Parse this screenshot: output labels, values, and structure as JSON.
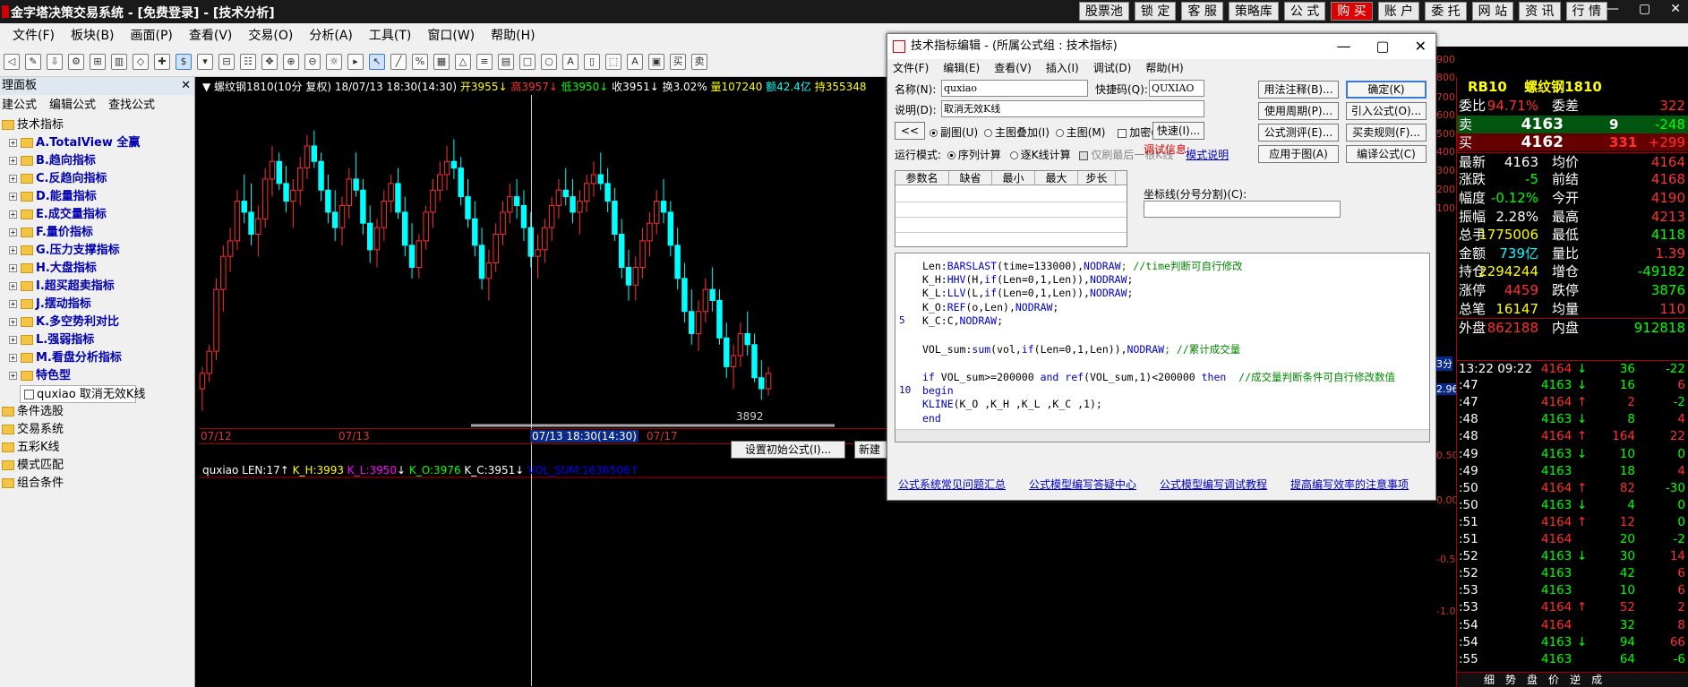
{
  "app": {
    "title": "金字塔决策交易系统 - [免费登录] - [技术分析]",
    "top_buttons": [
      "股票池",
      "锁 定",
      "客 服",
      "策略库",
      "公 式",
      "购 买",
      "账 户",
      "委 托",
      "网 站",
      "资 讯",
      "行 情"
    ],
    "window_controls": [
      "—",
      "▢",
      "✕"
    ]
  },
  "menu": [
    "文件(F)",
    "板块(B)",
    "画面(P)",
    "查看(V)",
    "交易(O)",
    "分析(A)",
    "工具(T)",
    "窗口(W)",
    "帮助(H)"
  ],
  "left_panel": {
    "header": "理面板",
    "tabs": [
      "建公式",
      "编辑公式",
      "查找公式"
    ],
    "tree": [
      {
        "label": "技术指标",
        "level": 0,
        "expanded": true
      },
      {
        "label": "A.TotalView 全赢",
        "level": 1
      },
      {
        "label": "B.趋向指标",
        "level": 1
      },
      {
        "label": "C.反趋向指标",
        "level": 1
      },
      {
        "label": "D.能量指标",
        "level": 1
      },
      {
        "label": "E.成交量指标",
        "level": 1
      },
      {
        "label": "F.量价指标",
        "level": 1
      },
      {
        "label": "G.压力支撑指标",
        "level": 1
      },
      {
        "label": "H.大盘指标",
        "level": 1
      },
      {
        "label": "I.超买超卖指标",
        "level": 1
      },
      {
        "label": "J.摆动指标",
        "level": 1
      },
      {
        "label": "K.多空势利对比",
        "level": 1
      },
      {
        "label": "L.强弱指标",
        "level": 1
      },
      {
        "label": "M.看盘分析指标",
        "level": 1
      },
      {
        "label": "特色型",
        "level": 1
      },
      {
        "label": "quxiao 取消无效K线",
        "level": 2
      },
      {
        "label": "条件选股",
        "level": 0
      },
      {
        "label": "交易系统",
        "level": 0
      },
      {
        "label": "五彩K线",
        "level": 0
      },
      {
        "label": "模式匹配",
        "level": 0
      },
      {
        "label": "组合条件",
        "level": 0
      }
    ]
  },
  "chart": {
    "header": [
      {
        "t": "▼ 螺纹钢1810(10分 复权) 18/07/13 18:30(14:30)",
        "c": "#ffffff"
      },
      {
        "t": " 开3955↓",
        "c": "#ffff00"
      },
      {
        "t": " 高3957↓",
        "c": "#ff3030"
      },
      {
        "t": " 低3950↓",
        "c": "#00ff00"
      },
      {
        "t": " 收3951↓",
        "c": "#ffffff"
      },
      {
        "t": " 换3.02%",
        "c": "#ffffff"
      },
      {
        "t": " 量107240",
        "c": "#ffff00"
      },
      {
        "t": " 额42.4亿",
        "c": "#00ffff"
      },
      {
        "t": " 持355348",
        "c": "#ffff00"
      }
    ],
    "dates": [
      "07/12",
      "07/13",
      "07/17"
    ],
    "selected_date": "07/13 18:30(14:30)",
    "low_label": "3892",
    "buttons": {
      "set_init": "设置初始公式(I)...",
      "new": "新建"
    },
    "sub_header": [
      {
        "t": "quxiao LEN:17↑",
        "c": "#ffffff"
      },
      {
        "t": " K_H:3993",
        "c": "#ffff00"
      },
      {
        "t": " K_L:3950",
        "c": "#ff00ff"
      },
      {
        "t": "↓",
        "c": "#ffffff"
      },
      {
        "t": " K_O:3976",
        "c": "#00ff00"
      },
      {
        "t": " K_C:3951↓",
        "c": "#ffffff"
      },
      {
        "t": " VOL_SUM:1636506↑",
        "c": "#0000ff"
      }
    ]
  },
  "chart_data": {
    "type": "candlestick",
    "note_units": "price",
    "ylim": [
      3880,
      4020
    ],
    "candles": [
      [
        3895,
        3905,
        3885,
        3902
      ],
      [
        3902,
        3915,
        3898,
        3912
      ],
      [
        3912,
        3945,
        3908,
        3940
      ],
      [
        3940,
        3960,
        3930,
        3955
      ],
      [
        3955,
        3968,
        3948,
        3962
      ],
      [
        3962,
        3985,
        3958,
        3980
      ],
      [
        3980,
        3992,
        3970,
        3975
      ],
      [
        3975,
        3988,
        3960,
        3965
      ],
      [
        3965,
        3978,
        3955,
        3972
      ],
      [
        3972,
        3995,
        3968,
        3990
      ],
      [
        3990,
        4005,
        3982,
        3998
      ],
      [
        3998,
        4002,
        3985,
        3988
      ],
      [
        3988,
        3996,
        3975,
        3980
      ],
      [
        3980,
        3990,
        3968,
        3985
      ],
      [
        3985,
        4000,
        3978,
        3995
      ],
      [
        3995,
        4010,
        3990,
        4005
      ],
      [
        4005,
        4012,
        3995,
        3998
      ],
      [
        3998,
        4002,
        3980,
        3985
      ],
      [
        3985,
        3992,
        3970,
        3975
      ],
      [
        3975,
        3985,
        3962,
        3968
      ],
      [
        3968,
        3982,
        3960,
        3978
      ],
      [
        3978,
        3995,
        3972,
        3990
      ],
      [
        3990,
        4002,
        3982,
        3985
      ],
      [
        3985,
        3990,
        3965,
        3970
      ],
      [
        3970,
        3978,
        3952,
        3958
      ],
      [
        3958,
        3972,
        3950,
        3968
      ],
      [
        3968,
        3985,
        3962,
        3980
      ],
      [
        3980,
        3992,
        3975,
        3988
      ],
      [
        3988,
        3995,
        3972,
        3975
      ],
      [
        3975,
        3982,
        3955,
        3960
      ],
      [
        3960,
        3970,
        3945,
        3950
      ],
      [
        3950,
        3965,
        3945,
        3962
      ],
      [
        3962,
        3978,
        3958,
        3975
      ],
      [
        3975,
        3990,
        3968,
        3985
      ],
      [
        3985,
        3998,
        3980,
        3992
      ],
      [
        3992,
        4005,
        3985,
        3998
      ],
      [
        3998,
        4008,
        3990,
        3995
      ],
      [
        3995,
        4000,
        3978,
        3982
      ],
      [
        3982,
        3990,
        3968,
        3972
      ],
      [
        3972,
        3980,
        3955,
        3960
      ],
      [
        3960,
        3968,
        3940,
        3945
      ],
      [
        3945,
        3958,
        3935,
        3952
      ],
      [
        3952,
        3970,
        3948,
        3965
      ],
      [
        3965,
        3980,
        3960,
        3975
      ],
      [
        3975,
        3988,
        3970,
        3982
      ],
      [
        3982,
        3990,
        3972,
        3978
      ],
      [
        3978,
        3985,
        3962,
        3968
      ],
      [
        3968,
        3975,
        3950,
        3955
      ],
      [
        3955,
        3965,
        3945,
        3958
      ],
      [
        3958,
        3972,
        3952,
        3968
      ],
      [
        3968,
        3982,
        3962,
        3978
      ],
      [
        3978,
        3990,
        3972,
        3985
      ],
      [
        3985,
        3995,
        3978,
        3982
      ],
      [
        3982,
        3990,
        3970,
        3975
      ],
      [
        3975,
        3985,
        3965,
        3980
      ],
      [
        3980,
        3992,
        3975,
        3988
      ],
      [
        3988,
        3998,
        3982,
        3992
      ],
      [
        3992,
        4002,
        3985,
        3988
      ],
      [
        3988,
        3995,
        3975,
        3980
      ],
      [
        3980,
        3986,
        3962,
        3965
      ],
      [
        3965,
        3972,
        3945,
        3950
      ],
      [
        3950,
        3958,
        3935,
        3942
      ],
      [
        3942,
        3955,
        3935,
        3950
      ],
      [
        3950,
        3968,
        3945,
        3962
      ],
      [
        3962,
        3975,
        3955,
        3970
      ],
      [
        3970,
        3985,
        3965,
        3980
      ],
      [
        3980,
        3990,
        3970,
        3975
      ],
      [
        3975,
        3980,
        3955,
        3960
      ],
      [
        3960,
        3968,
        3940,
        3945
      ],
      [
        3945,
        3952,
        3925,
        3930
      ],
      [
        3930,
        3940,
        3915,
        3920
      ],
      [
        3920,
        3935,
        3912,
        3930
      ],
      [
        3930,
        3945,
        3925,
        3940
      ],
      [
        3940,
        3950,
        3930,
        3935
      ],
      [
        3935,
        3940,
        3915,
        3918
      ],
      [
        3918,
        3925,
        3900,
        3905
      ],
      [
        3905,
        3915,
        3895,
        3910
      ],
      [
        3910,
        3925,
        3905,
        3920
      ],
      [
        3920,
        3930,
        3910,
        3915
      ],
      [
        3915,
        3920,
        3898,
        3900
      ],
      [
        3900,
        3908,
        3890,
        3895
      ],
      [
        3895,
        3905,
        3892,
        3902
      ]
    ]
  },
  "dialog": {
    "title": "技术指标编辑 - (所属公式组 : 技术指标)",
    "menu": [
      "文件(F)",
      "编辑(E)",
      "查看(V)",
      "插入(I)",
      "调试(D)",
      "帮助(H)"
    ],
    "name_label": "名称(N):",
    "name_value": "quxiao",
    "shortcut_label": "快捷码(Q):",
    "shortcut_value": "QUXIAO",
    "desc_label": "说明(D):",
    "desc_value": "取消无效K线",
    "nav_button": "<<",
    "draw_options": [
      "副图(U)",
      "主图叠加(I)",
      "主图(M)"
    ],
    "encrypt": "加密(Y)",
    "quick_button": "快速(I)...",
    "run_mode_label": "运行模式:",
    "run_modes": [
      "序列计算",
      "逐K线计算"
    ],
    "refresh_last": "仅刷最后一根K线",
    "mode_help": "模式说明",
    "param_headers": [
      "参数名",
      "缺省",
      "最小",
      "最大",
      "步长"
    ],
    "debug_label": "调试信息:",
    "axis_label": "坐标线(分号分割)(C):",
    "buttons_right": [
      [
        "用法注释(B)...",
        "确定(K)"
      ],
      [
        "使用周期(P)...",
        "引入公式(O)..."
      ],
      [
        "公式测评(E)...",
        "买卖规则(F)..."
      ],
      [
        "应用于图(A)",
        "编译公式(C)"
      ]
    ],
    "code": [
      {
        "n": "",
        "parts": [
          [
            "Len:",
            ""
          ],
          [
            "BARSLAST",
            "kw"
          ],
          [
            "(time=133000),",
            ""
          ],
          [
            "NODRAW",
            "kw"
          ],
          [
            "; //time判断可自行修改",
            "cm"
          ]
        ]
      },
      {
        "n": "",
        "parts": [
          [
            "K_H:",
            ""
          ],
          [
            "HHV",
            "kw"
          ],
          [
            "(H,",
            ""
          ],
          [
            "if",
            "kw"
          ],
          [
            "(Len=0,1,Len)),",
            ""
          ],
          [
            "NODRAW",
            "kw"
          ],
          [
            ";",
            ""
          ]
        ]
      },
      {
        "n": "",
        "parts": [
          [
            "K_L:",
            ""
          ],
          [
            "LLV",
            "kw"
          ],
          [
            "(L,",
            ""
          ],
          [
            "if",
            "kw"
          ],
          [
            "(Len=0,1,Len)),",
            ""
          ],
          [
            "NODRAW",
            "kw"
          ],
          [
            ";",
            ""
          ]
        ]
      },
      {
        "n": "",
        "parts": [
          [
            "K_O:",
            ""
          ],
          [
            "REF",
            "kw"
          ],
          [
            "(o,Len),",
            ""
          ],
          [
            "NODRAW",
            "kw"
          ],
          [
            ";",
            ""
          ]
        ]
      },
      {
        "n": "5",
        "parts": [
          [
            "K_C:C,",
            ""
          ],
          [
            "NODRAW",
            "kw"
          ],
          [
            ";",
            ""
          ]
        ]
      },
      {
        "n": "",
        "parts": [
          [
            "",
            ""
          ]
        ]
      },
      {
        "n": "",
        "parts": [
          [
            "VOL_sum:",
            ""
          ],
          [
            "sum",
            "kw"
          ],
          [
            "(vol,",
            ""
          ],
          [
            "if",
            "kw"
          ],
          [
            "(Len=0,1,Len)),",
            ""
          ],
          [
            "NODRAW",
            "kw"
          ],
          [
            "; //累计成交量",
            "cm"
          ]
        ]
      },
      {
        "n": "",
        "parts": [
          [
            "",
            ""
          ]
        ]
      },
      {
        "n": "",
        "parts": [
          [
            "if",
            "kw"
          ],
          [
            " VOL_sum>=200000 ",
            ""
          ],
          [
            "and",
            "kw"
          ],
          [
            " ",
            ""
          ],
          [
            "ref",
            "kw"
          ],
          [
            "(VOL_sum,1)<200000 ",
            ""
          ],
          [
            "then",
            "kw"
          ],
          [
            "  //成交量判断条件可自行修改数值",
            "cm"
          ]
        ]
      },
      {
        "n": "10",
        "parts": [
          [
            "begin",
            "kw"
          ]
        ]
      },
      {
        "n": "",
        "parts": [
          [
            "KLINE",
            "kw"
          ],
          [
            "(K_O ,K_H ,K_L ,K_C ,1);",
            ""
          ]
        ]
      },
      {
        "n": "",
        "parts": [
          [
            "end",
            "kw"
          ]
        ]
      }
    ],
    "links": [
      "公式系统常见问题汇总",
      "公式模型编写答疑中心",
      "公式模型编写调试教程",
      "提高编写效率的注意事项"
    ]
  },
  "scale": [
    "900",
    "800",
    "700",
    "600",
    "500",
    "400",
    "300",
    "200",
    "100",
    "3分",
    "2.96",
    "0.50",
    "0.00",
    "-0.50",
    "-1.00"
  ],
  "quote": {
    "symbol": "RB10",
    "name": "螺纹钢1810",
    "rows": [
      [
        "委比",
        "94.71%",
        "委差",
        "322"
      ],
      [
        "卖",
        "4163",
        "9",
        "-248"
      ],
      [
        "买",
        "4162",
        "331",
        "+299"
      ],
      [
        "最新",
        "4163",
        "均价",
        "4164"
      ],
      [
        "涨跌",
        "-5",
        "前结",
        "4168"
      ],
      [
        "幅度",
        "-0.12%",
        "今开",
        "4190"
      ],
      [
        "振幅",
        "2.28%",
        "最高",
        "4213"
      ],
      [
        "总手",
        "1775006",
        "最低",
        "4118"
      ],
      [
        "金额",
        "739亿",
        "量比",
        "1.39"
      ],
      [
        "持仓",
        "2294244",
        "增仓",
        "-49182"
      ],
      [
        "涨停",
        "4459",
        "跌停",
        "3876"
      ],
      [
        "总笔",
        "16147",
        "均量",
        "110"
      ],
      [
        "外盘",
        "862188",
        "内盘",
        "912818"
      ]
    ],
    "ticks": [
      [
        "13:22 09:22",
        "4164",
        "↓",
        "36",
        "-22"
      ],
      [
        ":47",
        "4163",
        "↓",
        "16",
        "6"
      ],
      [
        ":47",
        "4164",
        "↑",
        "2",
        "-2"
      ],
      [
        ":48",
        "4163",
        "↓",
        "8",
        "4"
      ],
      [
        ":48",
        "4164",
        "↑",
        "164",
        "22"
      ],
      [
        ":49",
        "4163",
        "↓",
        "10",
        "0"
      ],
      [
        ":49",
        "4163",
        "",
        "18",
        "4"
      ],
      [
        ":50",
        "4164",
        "↑",
        "82",
        "-30"
      ],
      [
        ":50",
        "4163",
        "↓",
        "4",
        "0"
      ],
      [
        ":51",
        "4164",
        "↑",
        "12",
        "0"
      ],
      [
        ":51",
        "4164",
        "",
        "20",
        "-2"
      ],
      [
        ":52",
        "4163",
        "↓",
        "30",
        "14"
      ],
      [
        ":52",
        "4163",
        "",
        "42",
        "6"
      ],
      [
        ":53",
        "4163",
        "",
        "10",
        "6"
      ],
      [
        ":53",
        "4164",
        "↑",
        "52",
        "2"
      ],
      [
        ":54",
        "4164",
        "",
        "32",
        "8"
      ],
      [
        ":54",
        "4163",
        "↓",
        "94",
        "66"
      ],
      [
        ":55",
        "4163",
        "",
        "64",
        "-6"
      ]
    ],
    "bottom_tabs": [
      "细",
      "势",
      "盘",
      "价",
      "逆",
      "成"
    ]
  }
}
